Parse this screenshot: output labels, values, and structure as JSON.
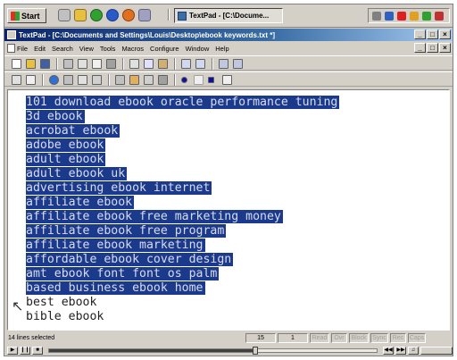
{
  "taskbar": {
    "start_label": "Start",
    "task_label": "TextPad - [C:\\Docume..."
  },
  "window": {
    "title": "TextPad - [C:\\Documents and Settings\\Louis\\Desktop\\ebook keywords.txt *]",
    "controls": [
      "_",
      "□",
      "×"
    ]
  },
  "menu": [
    "File",
    "Edit",
    "Search",
    "View",
    "Tools",
    "Macros",
    "Configure",
    "Window",
    "Help"
  ],
  "editor": {
    "lines": [
      "101 download ebook oracle performance tuning",
      "3d ebook",
      "acrobat ebook",
      "adobe ebook",
      "adult ebook",
      "adult ebook uk",
      "advertising ebook internet",
      "affiliate ebook",
      "affiliate ebook free marketing money",
      "affiliate ebook free program",
      "affiliate ebook marketing",
      "affordable ebook cover design",
      "amt ebook font font os palm",
      "based business ebook home",
      "best ebook",
      "bible ebook"
    ],
    "selected_count": 14
  },
  "status": {
    "text": "14 lines selected",
    "line": "15",
    "col": "1",
    "modes": [
      "Read",
      "Ovr",
      "Block",
      "Sync",
      "Rec",
      "Caps"
    ]
  },
  "colors": {
    "selection_bg": "#1c3a8c",
    "titlebar": "#0a246a"
  }
}
